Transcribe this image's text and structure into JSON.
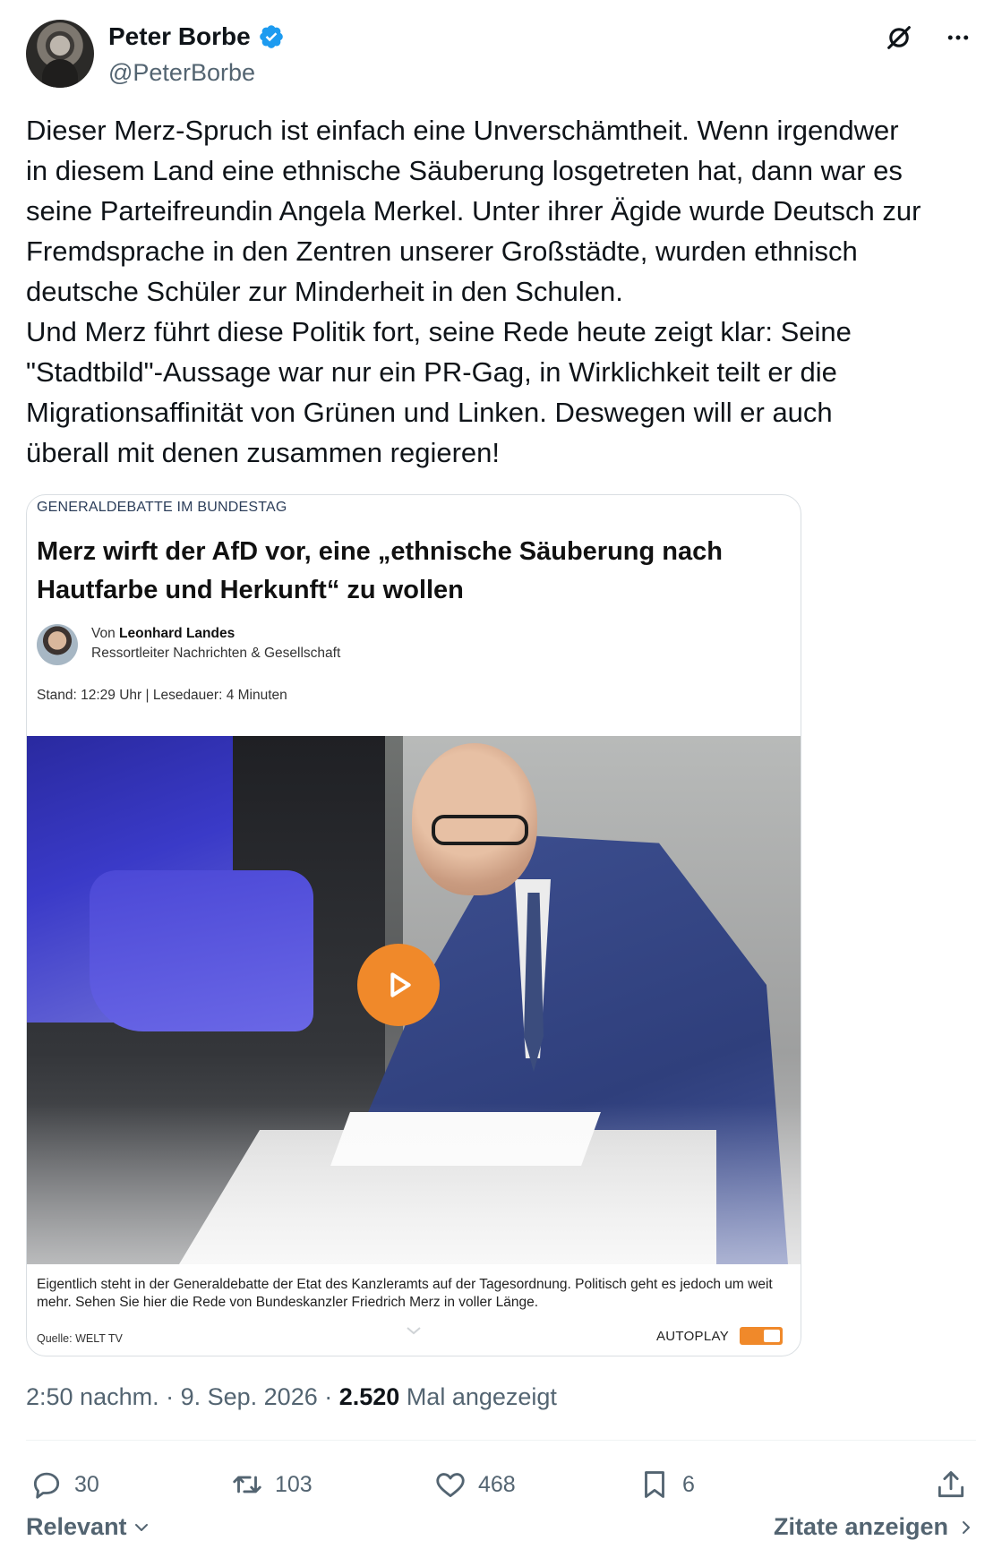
{
  "author": {
    "name": "Peter Borbe",
    "handle": "@PeterBorbe",
    "verified": true,
    "accent_color": "#1d9bf0"
  },
  "tweet": {
    "text": "Dieser Merz-Spruch ist einfach eine Unverschämtheit. Wenn irgendwer\nin diesem Land eine ethnische Säuberung losgetreten hat, dann war es\nseine Parteifreundin Angela Merkel. Unter ihrer Ägide wurde Deutsch zur\nFremdsprache in den Zentren unserer Großstädte, wurden ethnisch\ndeutsche Schüler zur Minderheit in den Schulen.\nUnd Merz führt diese Politik fort, seine Rede heute zeigt klar: Seine\n\"Stadtbild\"-Aussage war nur ein PR-Gag, in Wirklichkeit teilt er die\nMigrationsaffinität von Grünen und Linken. Deswegen will er auch\nüberall mit denen zusammen regieren!"
  },
  "card": {
    "kicker": "GENERALDEBATTE IM BUNDESTAG",
    "headline": "Merz wirft der AfD vor, eine „ethnische Säuberung nach Hautfarbe und Herkunft“ zu wollen",
    "author_prefix": "Von ",
    "author_name": "Leonhard Landes",
    "author_role": "Ressortleiter Nachrichten & Gesellschaft",
    "meta": "Stand: 12:29 Uhr  |  Lesedauer: 4 Minuten",
    "caption": "Eigentlich steht in der Generaldebatte der Etat des Kanzleramts auf der Tagesordnung. Politisch geht es jedoch um weit mehr. Sehen Sie hier die Rede von Bundeskanzler Friedrich Merz in voller Länge.",
    "source": "Quelle: WELT TV",
    "autoplay_label": "AUTOPLAY",
    "play_color": "#f0892a"
  },
  "timestamp": {
    "time": "2:50 nachm.",
    "sep1": " · ",
    "date": "9. Sep. 2026",
    "sep2": " · ",
    "views": "2.520",
    "views_suffix": " Mal angezeigt"
  },
  "actions": {
    "replies": "30",
    "reposts": "103",
    "likes": "468",
    "bookmarks": "6"
  },
  "footer": {
    "sort_label": "Relevant",
    "quotes_label": "Zitate anzeigen"
  }
}
